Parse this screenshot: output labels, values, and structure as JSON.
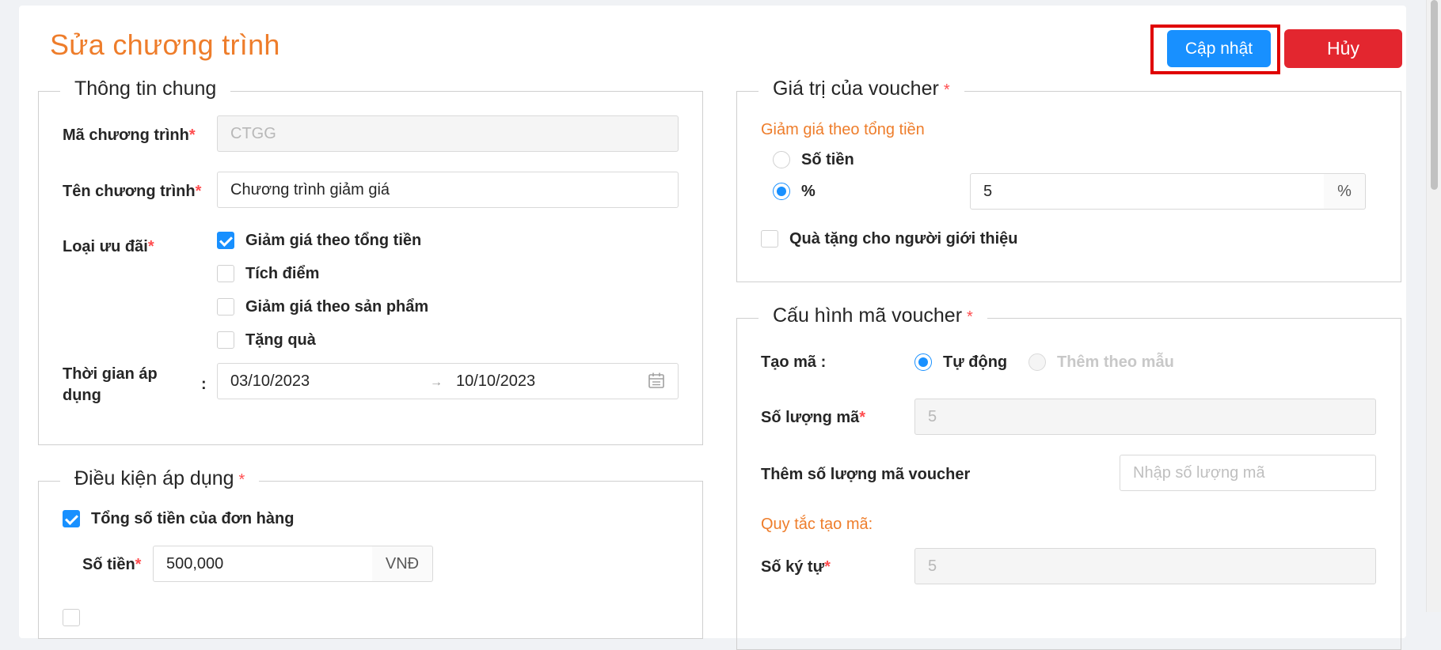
{
  "page": {
    "title": "Sửa chương trình"
  },
  "actions": {
    "update_label": "Cập nhật",
    "cancel_label": "Hủy"
  },
  "general": {
    "legend": "Thông tin chung",
    "code_label": "Mã chương trình",
    "code_value": "CTGG",
    "name_label": "Tên chương trình",
    "name_value": "Chương trình giảm giá",
    "type_label": "Loại ưu đãi",
    "types": [
      {
        "label": "Giảm giá theo tổng tiền",
        "checked": true
      },
      {
        "label": "Tích điểm",
        "checked": false
      },
      {
        "label": "Giảm giá theo sản phẩm",
        "checked": false
      },
      {
        "label": "Tặng quà",
        "checked": false
      }
    ],
    "time_label_line1": "Thời gian áp",
    "time_label_line2": "dụng",
    "time_colon": ":",
    "start_date": "03/10/2023",
    "end_date": "10/10/2023",
    "date_separator": "→"
  },
  "conditions": {
    "legend": "Điều kiện áp dụng",
    "order_total_label": "Tổng số tiền của đơn hàng",
    "order_total_checked": true,
    "amount_label": "Số tiền",
    "amount_value": "500,000",
    "amount_unit": "VNĐ"
  },
  "voucher_value": {
    "legend": "Giá trị của voucher",
    "section_title": "Giảm giá theo tổng tiền",
    "option_amount": "Số tiền",
    "option_percent": "%",
    "selected": "%",
    "percent_value": "5",
    "percent_unit": "%",
    "referrer_gift_label": "Quà tặng cho người giới thiệu",
    "referrer_gift_checked": false
  },
  "voucher_config": {
    "legend": "Cấu hình mã voucher",
    "create_label": "Tạo mã",
    "create_colon": ":",
    "auto_label": "Tự động",
    "template_label": "Thêm theo mẫu",
    "quantity_label": "Số lượng mã",
    "quantity_value": "5",
    "add_quantity_label": "Thêm số lượng mã voucher",
    "add_quantity_placeholder": "Nhập số lượng mã",
    "rules_title": "Quy tắc tạo mã:",
    "chars_label": "Số ký tự",
    "chars_value": "5"
  },
  "colors": {
    "accent": "#1890ff",
    "brand_orange": "#ee7d2b",
    "danger": "#e3262f",
    "required": "#ff4d4f"
  }
}
